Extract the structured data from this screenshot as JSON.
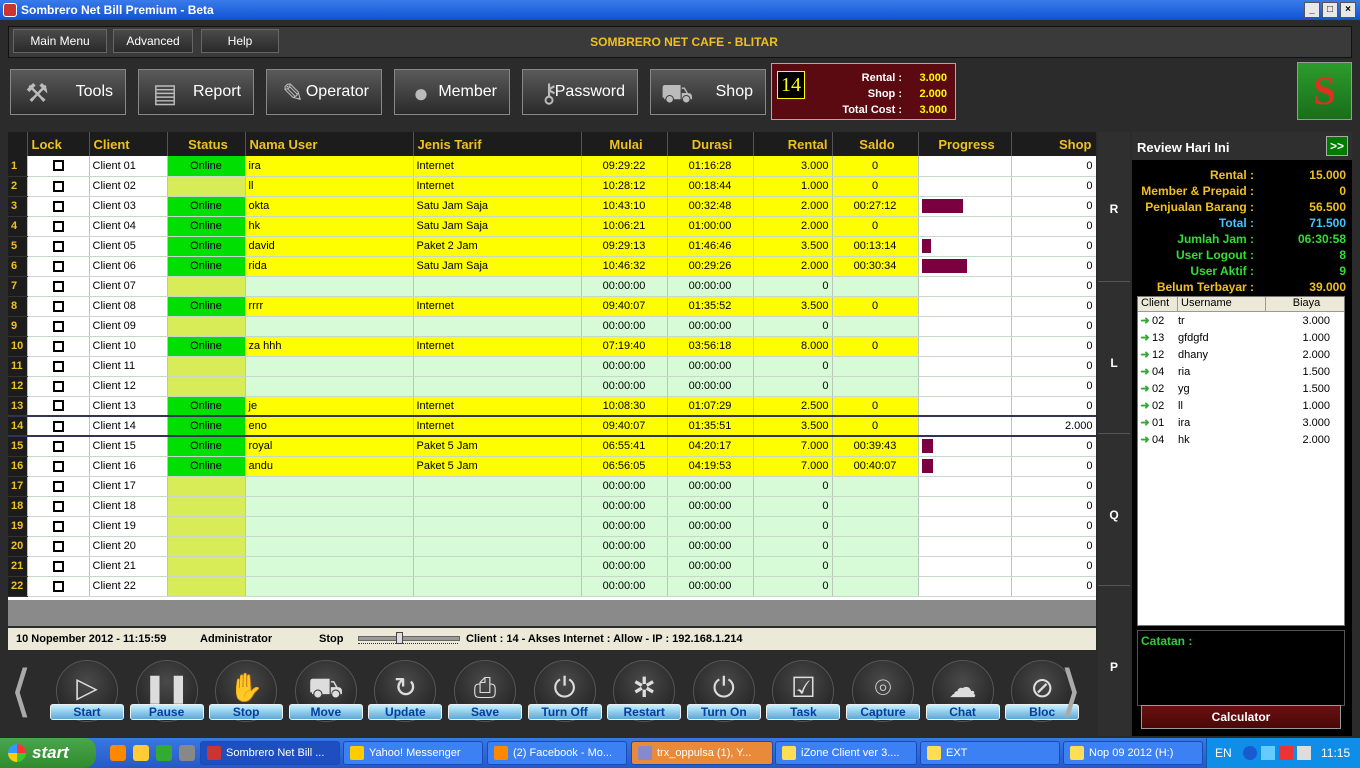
{
  "window": {
    "title": "Sombrero Net Bill Premium - Beta",
    "controls": [
      "_",
      "□",
      "×"
    ]
  },
  "menu": {
    "items": [
      "Main Menu",
      "Advanced",
      "Help"
    ],
    "cafe": "SOMBRERO NET CAFE - BLITAR"
  },
  "toolbar": [
    {
      "label": "Tools",
      "icon": "tools-icon"
    },
    {
      "label": "Report",
      "icon": "report-icon"
    },
    {
      "label": "Operator",
      "icon": "operator-icon"
    },
    {
      "label": "Member",
      "icon": "member-icon"
    },
    {
      "label": "Password",
      "icon": "key-icon"
    },
    {
      "label": "Shop",
      "icon": "cart-icon"
    }
  ],
  "summary": {
    "client_no": "14",
    "rental_label": "Rental :",
    "rental": "3.000",
    "shop_label": "Shop :",
    "shop": "2.000",
    "total_label": "Total Cost :",
    "total": "3.000"
  },
  "grid": {
    "columns": [
      "Lock",
      "Client",
      "Status",
      "Nama User",
      "Jenis Tarif",
      "Mulai",
      "Durasi",
      "Rental",
      "Saldo",
      "Progress",
      "Shop"
    ],
    "rows": [
      {
        "n": "1",
        "client": "Client 01",
        "status": "Online",
        "user": "ira",
        "tarif": "Internet",
        "mulai": "09:29:22",
        "durasi": "01:16:28",
        "rental": "3.000",
        "saldo": "0",
        "progress": 0,
        "shop": "0"
      },
      {
        "n": "2",
        "client": "Client 02",
        "status": "",
        "user": "ll",
        "tarif": "Internet",
        "mulai": "10:28:12",
        "durasi": "00:18:44",
        "rental": "1.000",
        "saldo": "0",
        "progress": 0,
        "shop": "0"
      },
      {
        "n": "3",
        "client": "Client 03",
        "status": "Online",
        "user": "okta",
        "tarif": "Satu Jam Saja",
        "mulai": "10:43:10",
        "durasi": "00:32:48",
        "rental": "2.000",
        "saldo": "00:27:12",
        "progress": 0.45,
        "shop": "0"
      },
      {
        "n": "4",
        "client": "Client 04",
        "status": "Online",
        "user": "hk",
        "tarif": "Satu Jam Saja",
        "mulai": "10:06:21",
        "durasi": "01:00:00",
        "rental": "2.000",
        "saldo": "0",
        "progress": 0,
        "shop": "0"
      },
      {
        "n": "5",
        "client": "Client 05",
        "status": "Online",
        "user": "david",
        "tarif": "Paket 2 Jam",
        "mulai": "09:29:13",
        "durasi": "01:46:46",
        "rental": "3.500",
        "saldo": "00:13:14",
        "progress": 0.1,
        "shop": "0"
      },
      {
        "n": "6",
        "client": "Client 06",
        "status": "Online",
        "user": "rida",
        "tarif": "Satu Jam Saja",
        "mulai": "10:46:32",
        "durasi": "00:29:26",
        "rental": "2.000",
        "saldo": "00:30:34",
        "progress": 0.5,
        "shop": "0"
      },
      {
        "n": "7",
        "client": "Client 07",
        "status": "",
        "user": "",
        "tarif": "",
        "mulai": "00:00:00",
        "durasi": "00:00:00",
        "rental": "0",
        "saldo": "",
        "progress": 0,
        "shop": "0"
      },
      {
        "n": "8",
        "client": "Client 08",
        "status": "Online",
        "user": "rrrr",
        "tarif": "Internet",
        "mulai": "09:40:07",
        "durasi": "01:35:52",
        "rental": "3.500",
        "saldo": "0",
        "progress": 0,
        "shop": "0"
      },
      {
        "n": "9",
        "client": "Client 09",
        "status": "",
        "user": "",
        "tarif": "",
        "mulai": "00:00:00",
        "durasi": "00:00:00",
        "rental": "0",
        "saldo": "",
        "progress": 0,
        "shop": "0"
      },
      {
        "n": "10",
        "client": "Client 10",
        "status": "Online",
        "user": "za hhh",
        "tarif": "Internet",
        "mulai": "07:19:40",
        "durasi": "03:56:18",
        "rental": "8.000",
        "saldo": "0",
        "progress": 0,
        "shop": "0"
      },
      {
        "n": "11",
        "client": "Client 11",
        "status": "",
        "user": "",
        "tarif": "",
        "mulai": "00:00:00",
        "durasi": "00:00:00",
        "rental": "0",
        "saldo": "",
        "progress": 0,
        "shop": "0"
      },
      {
        "n": "12",
        "client": "Client 12",
        "status": "",
        "user": "",
        "tarif": "",
        "mulai": "00:00:00",
        "durasi": "00:00:00",
        "rental": "0",
        "saldo": "",
        "progress": 0,
        "shop": "0"
      },
      {
        "n": "13",
        "client": "Client 13",
        "status": "Online",
        "user": "je",
        "tarif": "Internet",
        "mulai": "10:08:30",
        "durasi": "01:07:29",
        "rental": "2.500",
        "saldo": "0",
        "progress": 0,
        "shop": "0"
      },
      {
        "n": "14",
        "client": "Client 14",
        "status": "Online",
        "user": "eno",
        "tarif": "Internet",
        "mulai": "09:40:07",
        "durasi": "01:35:51",
        "rental": "3.500",
        "saldo": "0",
        "progress": 0,
        "shop": "2.000",
        "selected": true
      },
      {
        "n": "15",
        "client": "Client 15",
        "status": "Online",
        "user": "royal",
        "tarif": "Paket 5 Jam",
        "mulai": "06:55:41",
        "durasi": "04:20:17",
        "rental": "7.000",
        "saldo": "00:39:43",
        "progress": 0.12,
        "shop": "0"
      },
      {
        "n": "16",
        "client": "Client 16",
        "status": "Online",
        "user": "andu",
        "tarif": "Paket 5 Jam",
        "mulai": "06:56:05",
        "durasi": "04:19:53",
        "rental": "7.000",
        "saldo": "00:40:07",
        "progress": 0.12,
        "shop": "0"
      },
      {
        "n": "17",
        "client": "Client 17",
        "status": "",
        "user": "",
        "tarif": "",
        "mulai": "00:00:00",
        "durasi": "00:00:00",
        "rental": "0",
        "saldo": "",
        "progress": 0,
        "shop": "0"
      },
      {
        "n": "18",
        "client": "Client 18",
        "status": "",
        "user": "",
        "tarif": "",
        "mulai": "00:00:00",
        "durasi": "00:00:00",
        "rental": "0",
        "saldo": "",
        "progress": 0,
        "shop": "0"
      },
      {
        "n": "19",
        "client": "Client 19",
        "status": "",
        "user": "",
        "tarif": "",
        "mulai": "00:00:00",
        "durasi": "00:00:00",
        "rental": "0",
        "saldo": "",
        "progress": 0,
        "shop": "0"
      },
      {
        "n": "20",
        "client": "Client 20",
        "status": "",
        "user": "",
        "tarif": "",
        "mulai": "00:00:00",
        "durasi": "00:00:00",
        "rental": "0",
        "saldo": "",
        "progress": 0,
        "shop": "0"
      },
      {
        "n": "21",
        "client": "Client 21",
        "status": "",
        "user": "",
        "tarif": "",
        "mulai": "00:00:00",
        "durasi": "00:00:00",
        "rental": "0",
        "saldo": "",
        "progress": 0,
        "shop": "0"
      },
      {
        "n": "22",
        "client": "Client 22",
        "status": "",
        "user": "",
        "tarif": "",
        "mulai": "00:00:00",
        "durasi": "00:00:00",
        "rental": "0",
        "saldo": "",
        "progress": 0,
        "shop": "0"
      }
    ]
  },
  "status": {
    "date": "10 Nopember 2012  -  11:15:59",
    "user": "Administrator",
    "stop_label": "Stop",
    "info": "Client : 14 - Akses Internet : Allow - IP : 192.168.1.214"
  },
  "sidetabs": [
    "R",
    "L",
    "Q",
    "P"
  ],
  "review": {
    "title": "Review Hari Ini",
    "more": ">>",
    "rows": [
      {
        "k": "Rental :",
        "v": "15.000",
        "color": "#f0c020"
      },
      {
        "k": "Member & Prepaid :",
        "v": "0",
        "color": "#f0c020"
      },
      {
        "k": "Penjualan Barang :",
        "v": "56.500",
        "color": "#f0c020"
      },
      {
        "k": "Total :",
        "v": "71.500",
        "color": "#40c8ff"
      },
      {
        "k": "Jumlah Jam :",
        "v": "06:30:58",
        "color": "#33dd33"
      },
      {
        "k": "User Logout :",
        "v": "8",
        "color": "#33dd33"
      },
      {
        "k": "User Aktif :",
        "v": "9",
        "color": "#33dd33"
      },
      {
        "k": "Belum Terbayar :",
        "v": "39.000",
        "color": "#f0c020"
      }
    ],
    "log_columns": [
      "Client",
      "Username",
      "Biaya"
    ],
    "log": [
      {
        "c": "02",
        "u": "tr",
        "b": "3.000"
      },
      {
        "c": "13",
        "u": "gfdgfd",
        "b": "1.000"
      },
      {
        "c": "12",
        "u": "dhany",
        "b": "2.000"
      },
      {
        "c": "04",
        "u": "ria",
        "b": "1.500"
      },
      {
        "c": "02",
        "u": "yg",
        "b": "1.500"
      },
      {
        "c": "02",
        "u": "ll",
        "b": "1.000"
      },
      {
        "c": "01",
        "u": "ira",
        "b": "3.000"
      },
      {
        "c": "04",
        "u": "hk",
        "b": "2.000"
      }
    ],
    "notes_label": "Catatan :",
    "calculator": "Calculator"
  },
  "actions": [
    "Start",
    "Pause",
    "Stop",
    "Move",
    "Update",
    "Save",
    "Turn Off",
    "Restart",
    "Turn On",
    "Task",
    "Capture",
    "Chat",
    "Bloc"
  ],
  "action_glyphs": [
    "▷",
    "❚❚",
    "✋",
    "⛟",
    "↻",
    "⎙",
    "⏻",
    "✲",
    "⏻",
    "☑",
    "⌾",
    "☁",
    "⊘"
  ],
  "taskbar": {
    "start": "start",
    "tasks": [
      "Sombrero Net Bill ...",
      "Yahoo! Messenger",
      "(2) Facebook - Mo...",
      "trx_oppulsa (1), Y...",
      "iZone Client ver 3....",
      "EXT",
      "Nop 09 2012 (H:)"
    ],
    "lang": "EN",
    "clock": "11:15"
  },
  "colors": {
    "accent": "#f0c020",
    "online": "#00e000",
    "row_active": "#fefe00",
    "row_idle": "#d6fbd6",
    "progress": "#7a0040"
  }
}
